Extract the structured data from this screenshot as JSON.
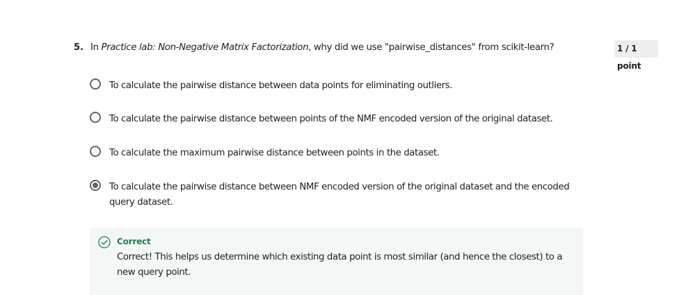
{
  "question": {
    "number": "5.",
    "text_prefix": "In ",
    "text_italic": "Practice lab: Non-Negative Matrix Factorization",
    "text_suffix": ", why did we use \"pairwise_distances\" from scikit-learn?",
    "points": "1 / 1 point"
  },
  "options": [
    {
      "label": "To calculate the pairwise distance between data points for eliminating outliers.",
      "selected": false
    },
    {
      "label": "To calculate the pairwise distance between points of the NMF encoded version of the original dataset.",
      "selected": false
    },
    {
      "label": "To calculate the maximum pairwise distance between points in the dataset.",
      "selected": false
    },
    {
      "label": "To calculate the pairwise distance between NMF encoded version of the original dataset and the encoded query dataset.",
      "selected": true
    }
  ],
  "feedback": {
    "status": "Correct",
    "message": "Correct! This helps us determine which existing data point is most similar (and hence the closest) to a new query point.",
    "icon": "check-circle-icon",
    "color": "#1e7f4e",
    "background": "#f3f8f6"
  }
}
